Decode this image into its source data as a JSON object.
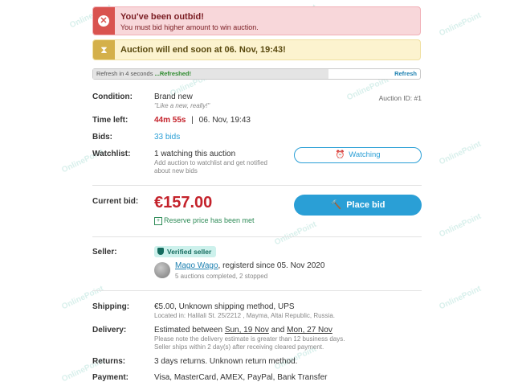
{
  "watermark": "OnlinePoint",
  "alerts": {
    "outbid_title": "You've been outbid!",
    "outbid_text": "You must bid higher amount to win auction.",
    "ending_text": "Auction will end soon at 06. Nov, 19:43!"
  },
  "refresh": {
    "status_prefix": "Refresh in 4 seconds",
    "status_ok": "...Refreshed!",
    "link": "Refresh",
    "progress": 0.72
  },
  "auction": {
    "id_label": "Auction ID:",
    "id_value": "#1",
    "condition_label": "Condition:",
    "condition_value": "Brand new",
    "condition_note": "\"Like a new, really!\"",
    "time_left_label": "Time left:",
    "time_left_value": "44m 55s",
    "time_sep": "|",
    "end_time": "06. Nov, 19:43",
    "bids_label": "Bids:",
    "bids_value": "33 bids",
    "watchlist_label": "Watchlist:",
    "watchlist_value": "1 watching this auction",
    "watchlist_note": "Add auction to watchlist and get notified about new bids",
    "watching_button": "Watching"
  },
  "bid": {
    "label": "Current bid:",
    "price": "€157.00",
    "reserve_text": "Reserve price has been met",
    "place_bid_button": "Place bid"
  },
  "seller": {
    "label": "Seller:",
    "verified": "Verified seller",
    "name": "Mago Wago",
    "since": ", registerd since 05. Nov 2020",
    "stats": "5 auctions completed, 2 stopped"
  },
  "shipping": {
    "label": "Shipping:",
    "value": "€5.00, Unknown shipping method, UPS",
    "location": "Located in: Halilali St. 25/2212 , Mayma, Altai Republic, Russia."
  },
  "delivery": {
    "label": "Delivery:",
    "prefix": "Estimated between ",
    "date1": "Sun, 19 Nov",
    "and": " and ",
    "date2": "Mon, 27 Nov",
    "note1": "Please note the delivery estimate is greater than 12 business days.",
    "note2": "Seller ships within 2 day(s) after receiving cleared payment."
  },
  "returns": {
    "label": "Returns:",
    "value": "3 days returns. Unknown return method."
  },
  "payment": {
    "label": "Payment:",
    "value": "Visa, MasterCard, AMEX, PayPal, Bank Transfer"
  },
  "colors": {
    "accent": "#2a9fd6",
    "price": "#c4222b",
    "success": "#2e8b57",
    "danger": "#d9534f",
    "warning": "#d4b04a"
  },
  "icons": {
    "outbid": "close-circle-icon",
    "ending": "hourglass-icon",
    "watching": "alarm-clock-icon",
    "place_bid": "gavel-icon",
    "reserve": "checkbox-icon",
    "verified": "shield-check-icon"
  }
}
